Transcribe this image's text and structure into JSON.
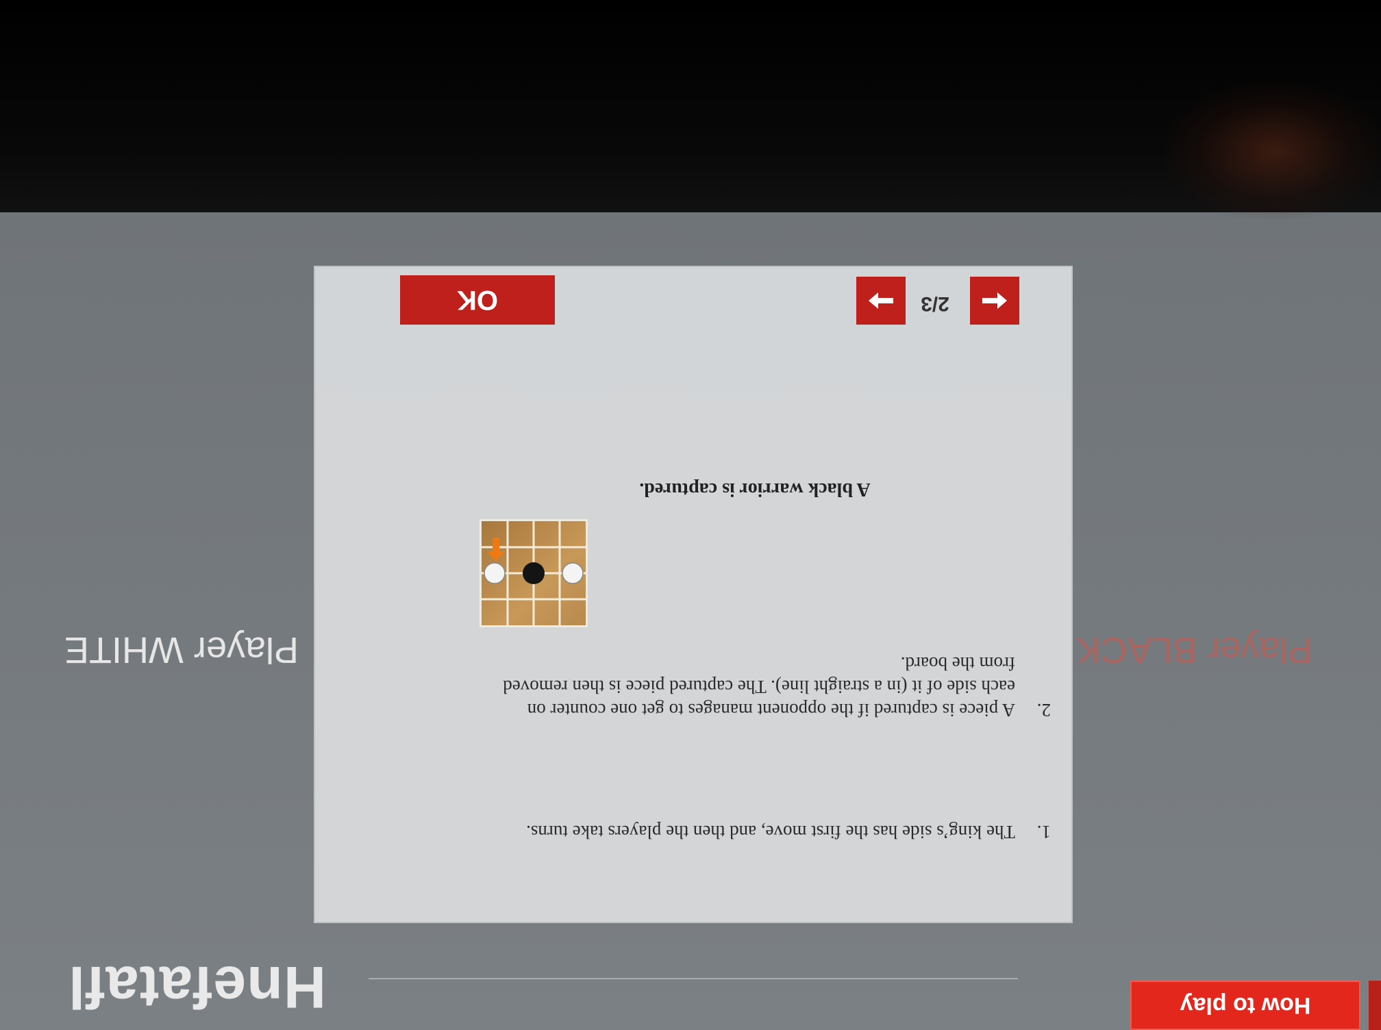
{
  "app": {
    "title": "Hnefatafl",
    "how_to_play_label": "How to play"
  },
  "players": {
    "black_label": "Player BLACK",
    "white_label": "Player WHITE"
  },
  "dialog": {
    "rules": [
      {
        "number": "1.",
        "text": "The king’s side has the first move, and then the players take turns."
      },
      {
        "number": "2.",
        "text": "A piece is captured if the opponent manages to get one counter on each side of it (in a straight line). The captured piece is then removed from the board."
      }
    ],
    "figure_caption": "A black warrior is captured.",
    "page_indicator": "2/3",
    "ok_label": "OK"
  },
  "icons": {
    "prev": "arrow-left-icon",
    "next": "arrow-right-icon"
  },
  "colors": {
    "accent_red": "#c0201c",
    "how_to_play_red": "#e3271c",
    "background_gray": "#767b7f",
    "dialog_bg": "#d6d8da"
  }
}
